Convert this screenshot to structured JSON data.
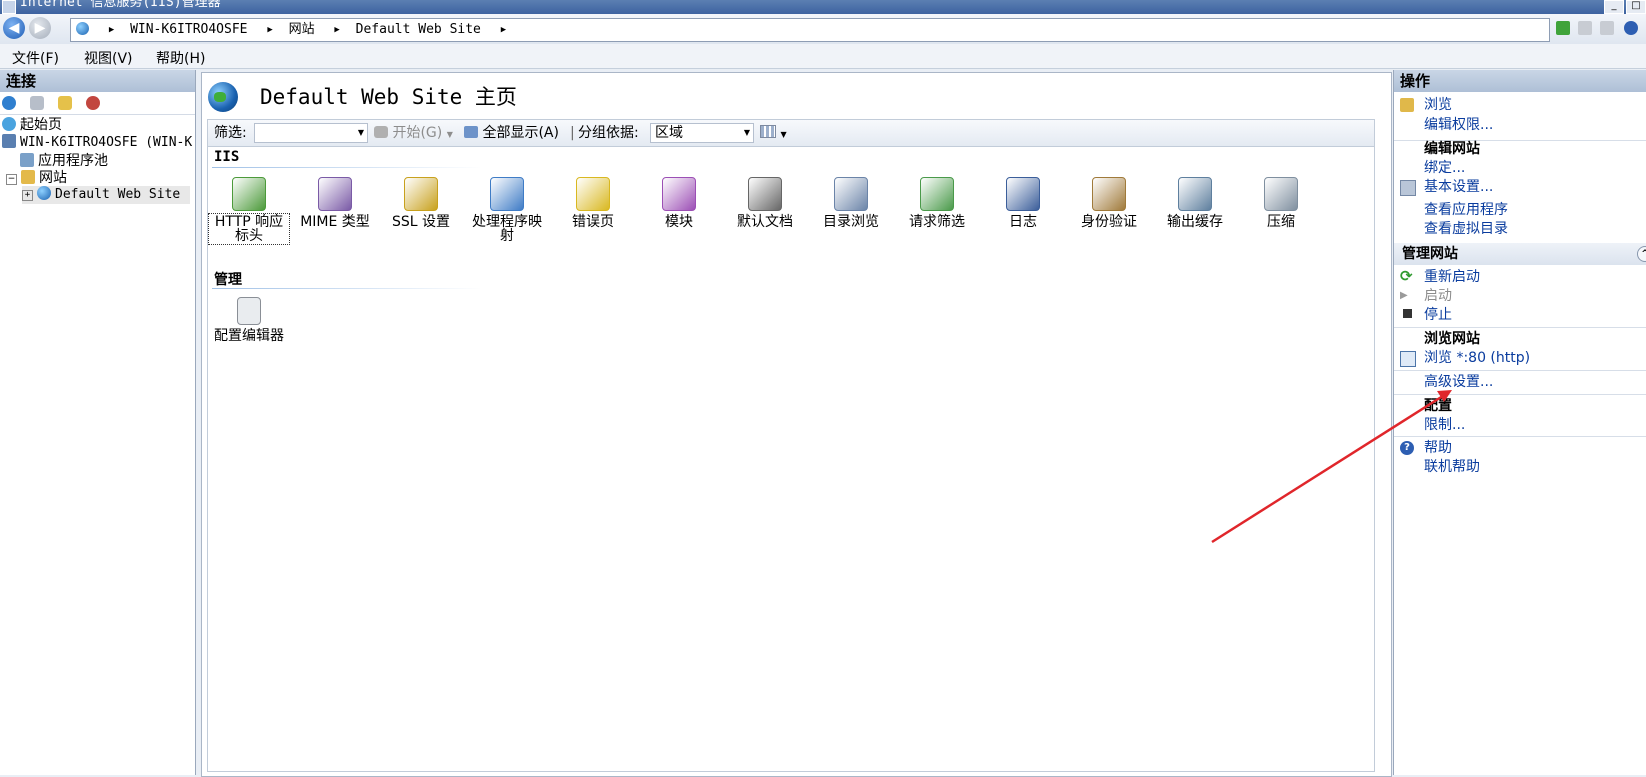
{
  "window": {
    "title": "Internet 信息服务(IIS)管理器"
  },
  "address": {
    "segments": [
      "WIN-K6ITRO4OSFE",
      "网站",
      "Default Web Site"
    ]
  },
  "menu": {
    "items": [
      "文件(F)",
      "视图(V)",
      "帮助(H)"
    ]
  },
  "connections": {
    "title": "连接",
    "tree": {
      "start_page": "起始页",
      "server": "WIN-K6ITRO4OSFE (WIN-K",
      "app_pools": "应用程序池",
      "sites": "网站",
      "default_site": "Default Web Site"
    }
  },
  "main": {
    "title": "Default Web Site 主页",
    "filter": {
      "label": "筛选:",
      "value": "",
      "start": "开始(G)",
      "show_all": "全部显示(A)",
      "group_label": "分组依据:",
      "group_value": "区域"
    },
    "groups": {
      "iis": "IIS",
      "manage": "管理"
    },
    "features": [
      {
        "line1": "HTTP 响应",
        "line2": "标头",
        "icon": "http-headers-icon",
        "color": "#4c9a3a"
      },
      {
        "line1": "MIME 类型",
        "line2": "",
        "icon": "mime-types-icon",
        "color": "#7a5aa6"
      },
      {
        "line1": "SSL 设置",
        "line2": "",
        "icon": "lock-icon",
        "color": "#c8a11d"
      },
      {
        "line1": "处理程序映",
        "line2": "射",
        "icon": "handler-mappings-icon",
        "color": "#3f7cc6"
      },
      {
        "line1": "错误页",
        "line2": "",
        "icon": "error-pages-icon",
        "color": "#d9b820"
      },
      {
        "line1": "模块",
        "line2": "",
        "icon": "modules-icon",
        "color": "#9c4fb5"
      },
      {
        "line1": "默认文档",
        "line2": "",
        "icon": "default-document-icon",
        "color": "#666666"
      },
      {
        "line1": "目录浏览",
        "line2": "",
        "icon": "directory-browsing-icon",
        "color": "#6b84a8"
      },
      {
        "line1": "请求筛选",
        "line2": "",
        "icon": "request-filtering-icon",
        "color": "#4a9a4a"
      },
      {
        "line1": "日志",
        "line2": "",
        "icon": "logging-icon",
        "color": "#3b5e9a"
      },
      {
        "line1": "身份验证",
        "line2": "",
        "icon": "authentication-icon",
        "color": "#a07a3a"
      },
      {
        "line1": "输出缓存",
        "line2": "",
        "icon": "output-caching-icon",
        "color": "#5e7f9e"
      },
      {
        "line1": "压缩",
        "line2": "",
        "icon": "compression-icon",
        "color": "#7f8f9f"
      }
    ],
    "manage_features": [
      {
        "line1": "配置编辑器",
        "icon": "configuration-editor-icon",
        "color": "#8a8f96"
      }
    ]
  },
  "actions": {
    "title": "操作",
    "explore": "浏览",
    "edit_permissions": "编辑权限...",
    "edit_site_header": "编辑网站",
    "bindings": "绑定...",
    "basic_settings": "基本设置...",
    "view_applications": "查看应用程序",
    "view_virtual_dirs": "查看虚拟目录",
    "manage_site_header": "管理网站",
    "restart": "重新启动",
    "start": "启动",
    "stop": "停止",
    "browse_site_header": "浏览网站",
    "browse_80": "浏览 *:80 (http)",
    "advanced_settings": "高级设置...",
    "config_header": "配置",
    "limits": "限制...",
    "help": "帮助",
    "online_help": "联机帮助"
  },
  "colors": {
    "arrow": "#e0262b",
    "link": "#0a3c9e"
  }
}
